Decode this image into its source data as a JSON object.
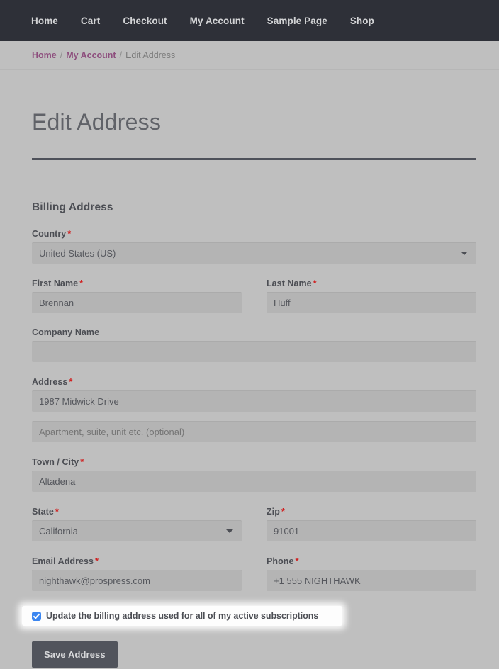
{
  "nav": {
    "items": [
      {
        "label": "Home"
      },
      {
        "label": "Cart"
      },
      {
        "label": "Checkout"
      },
      {
        "label": "My Account"
      },
      {
        "label": "Sample Page"
      },
      {
        "label": "Shop"
      }
    ]
  },
  "breadcrumb": {
    "home": "Home",
    "sep1": "/",
    "account": "My Account",
    "sep2": "/",
    "current": "Edit Address"
  },
  "page": {
    "title": "Edit Address",
    "section_title": "Billing Address"
  },
  "form": {
    "country": {
      "label": "Country",
      "required": "*",
      "value": "United States (US)"
    },
    "first_name": {
      "label": "First Name",
      "required": "*",
      "value": "Brennan"
    },
    "last_name": {
      "label": "Last Name",
      "required": "*",
      "value": "Huff"
    },
    "company": {
      "label": "Company Name",
      "value": ""
    },
    "address1": {
      "label": "Address",
      "required": "*",
      "value": "1987 Midwick Drive"
    },
    "address2": {
      "placeholder": "Apartment, suite, unit etc. (optional)",
      "value": ""
    },
    "city": {
      "label": "Town / City",
      "required": "*",
      "value": "Altadena"
    },
    "state": {
      "label": "State",
      "required": "*",
      "value": "California"
    },
    "zip": {
      "label": "Zip",
      "required": "*",
      "value": "91001"
    },
    "email": {
      "label": "Email Address",
      "required": "*",
      "value": "nighthawk@prospress.com"
    },
    "phone": {
      "label": "Phone",
      "required": "*",
      "value": "+1 555 NIGHTHAWK"
    },
    "update_subscriptions": {
      "label": "Update the billing address used for all of my active subscriptions",
      "checked": true
    },
    "submit": {
      "label": "Save Address"
    }
  },
  "colors": {
    "nav_bg": "#2e3038",
    "page_bg": "#bfbfbf",
    "input_bg": "#b4b4b4",
    "link": "#8e4f7e",
    "required": "#d02020",
    "checkbox": "#3b86f0",
    "button_bg": "#51545c"
  }
}
